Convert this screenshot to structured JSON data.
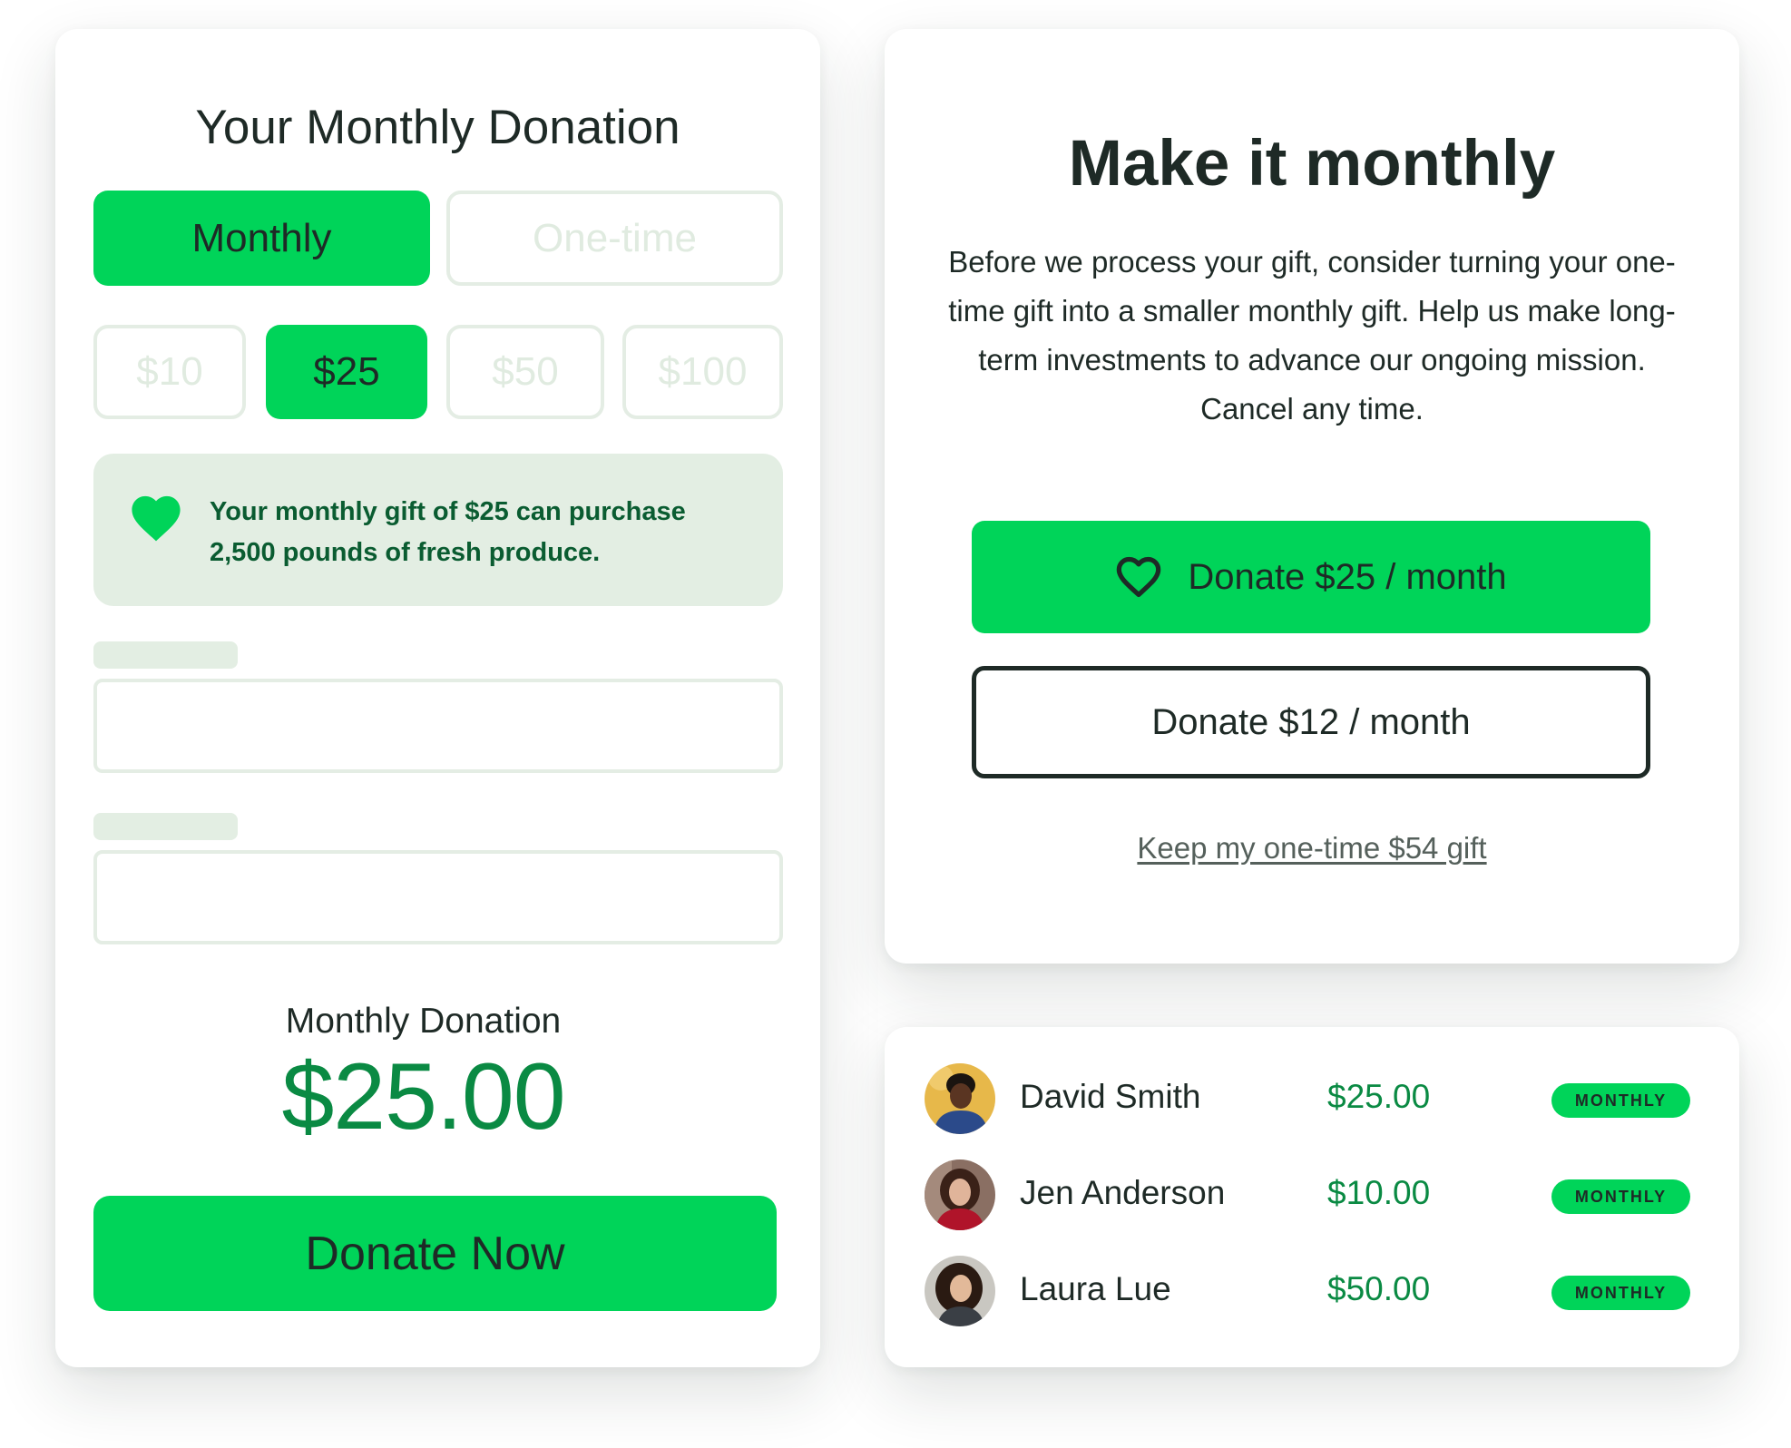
{
  "colors": {
    "brand_green": "#00d459",
    "dark_green_text": "#0a8a43",
    "impact_text": "#0a5c31",
    "ink": "#1e2a26",
    "panel_tint": "#e3eee3",
    "muted_border": "#e4ede4"
  },
  "donation_form": {
    "title": "Your Monthly Donation",
    "frequency": {
      "monthly_label": "Monthly",
      "onetime_label": "One-time",
      "selected": "Monthly"
    },
    "amounts": [
      {
        "label": "$10",
        "selected": false
      },
      {
        "label": "$25",
        "selected": true
      },
      {
        "label": "$50",
        "selected": false
      },
      {
        "label": "$100",
        "selected": false
      }
    ],
    "impact": {
      "icon": "heart-icon",
      "text": "Your monthly gift of $25 can purchase 2,500 pounds of fresh produce."
    },
    "summary": {
      "label": "Monthly Donation",
      "amount": "$25.00"
    },
    "submit_label": "Donate Now"
  },
  "upsell": {
    "title": "Make it monthly",
    "body": "Before we process your gift, consider turning your one-time gift into a smaller monthly gift. Help us make long-term investments to advance our ongoing mission. Cancel any time.",
    "primary_icon": "heart-outline-icon",
    "primary_label": "Donate $25 / month",
    "secondary_label": "Donate $12 / month",
    "keep_link": "Keep my one-time $54 gift"
  },
  "donors": [
    {
      "name": "David Smith",
      "amount": "$25.00",
      "badge": "MONTHLY",
      "avatar": "avatar-david"
    },
    {
      "name": "Jen Anderson",
      "amount": "$10.00",
      "badge": "MONTHLY",
      "avatar": "avatar-jen"
    },
    {
      "name": "Laura Lue",
      "amount": "$50.00",
      "badge": "MONTHLY",
      "avatar": "avatar-laura"
    }
  ]
}
